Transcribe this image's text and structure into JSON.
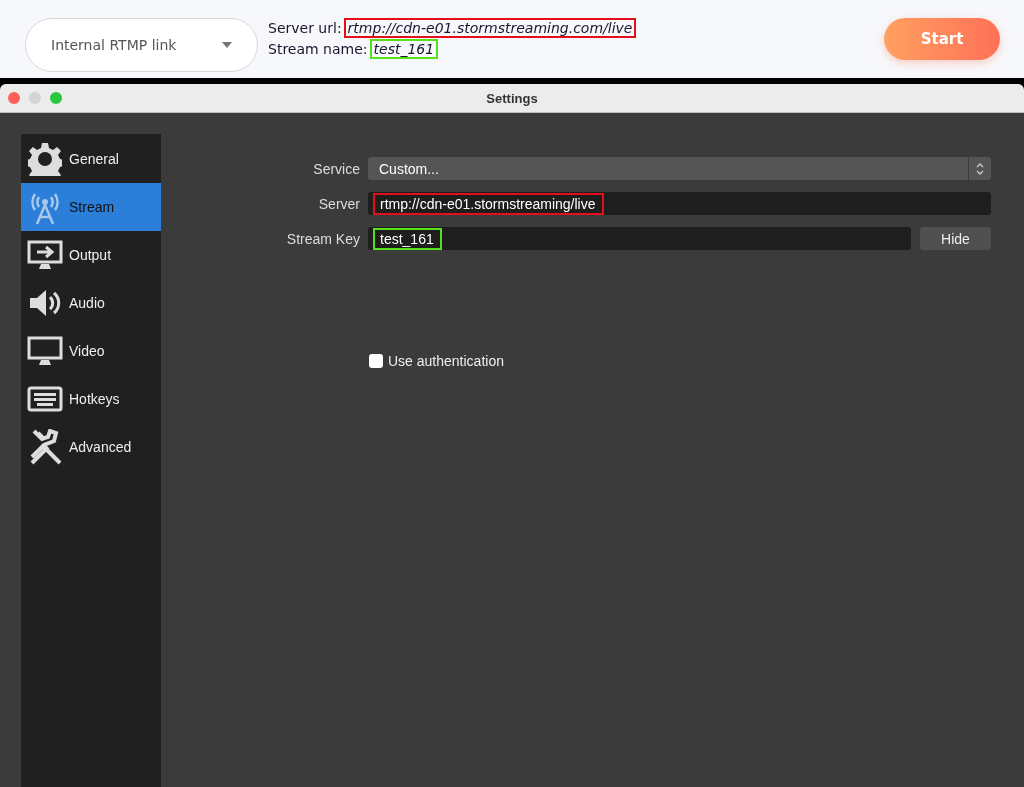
{
  "top_bar": {
    "dropdown": {
      "value": "Internal RTMP link"
    },
    "details": [
      {
        "label": "Server url:",
        "value": "rtmp://cdn-e01.stormstreaming.com/live",
        "color": "#e3101b"
      },
      {
        "label": "Stream name:",
        "value": "test_161",
        "color": "#55e01a"
      }
    ],
    "start_button": "Start"
  },
  "window": {
    "title": "Settings"
  },
  "sidebar": {
    "items": [
      {
        "label": "General",
        "selected": false
      },
      {
        "label": "Stream",
        "selected": true
      },
      {
        "label": "Output",
        "selected": false
      },
      {
        "label": "Audio",
        "selected": false
      },
      {
        "label": "Video",
        "selected": false
      },
      {
        "label": "Hotkeys",
        "selected": false
      },
      {
        "label": "Advanced",
        "selected": false
      }
    ]
  },
  "form": {
    "service": {
      "label": "Service",
      "value": "Custom..."
    },
    "server": {
      "label": "Server",
      "value": "rtmp://cdn-e01.stormstreaming/live",
      "color": "#e3101b"
    },
    "stream_key": {
      "label": "Stream Key",
      "value": "test_161",
      "color": "#55e01a",
      "button": "Hide"
    },
    "use_authentication": {
      "label": "Use authentication",
      "checked": false
    }
  }
}
